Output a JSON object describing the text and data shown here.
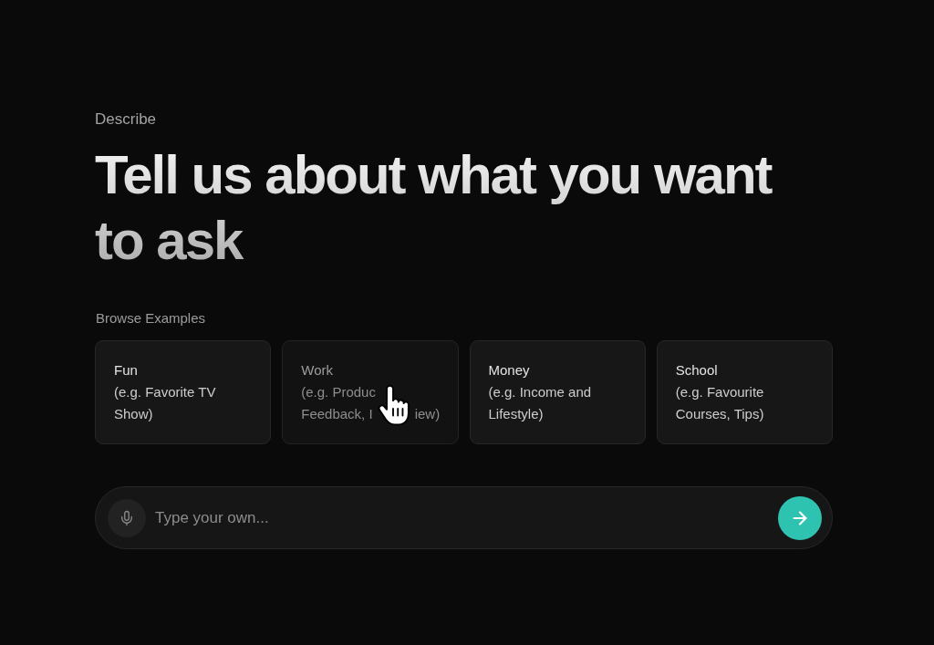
{
  "header": {
    "eyebrow": "Describe",
    "title": "Tell us about what you want to ask"
  },
  "examples": {
    "label": "Browse Examples",
    "cards": [
      {
        "title": "Fun",
        "lines": [
          [
            "(e.g. Favorite TV"
          ],
          [
            "Show)"
          ]
        ],
        "hovered": false
      },
      {
        "title": "Work",
        "lines": [
          [
            "(e.g. Produc"
          ],
          [
            "Feedback, I",
            "iew)"
          ]
        ],
        "hovered": true
      },
      {
        "title": "Money",
        "lines": [
          [
            "(e.g. Income and"
          ],
          [
            "Lifestyle)"
          ]
        ],
        "hovered": false
      },
      {
        "title": "School",
        "lines": [
          [
            "(e.g. Favourite"
          ],
          [
            "Courses, Tips)"
          ]
        ],
        "hovered": false
      }
    ]
  },
  "composer": {
    "placeholder": "Type your own..."
  }
}
